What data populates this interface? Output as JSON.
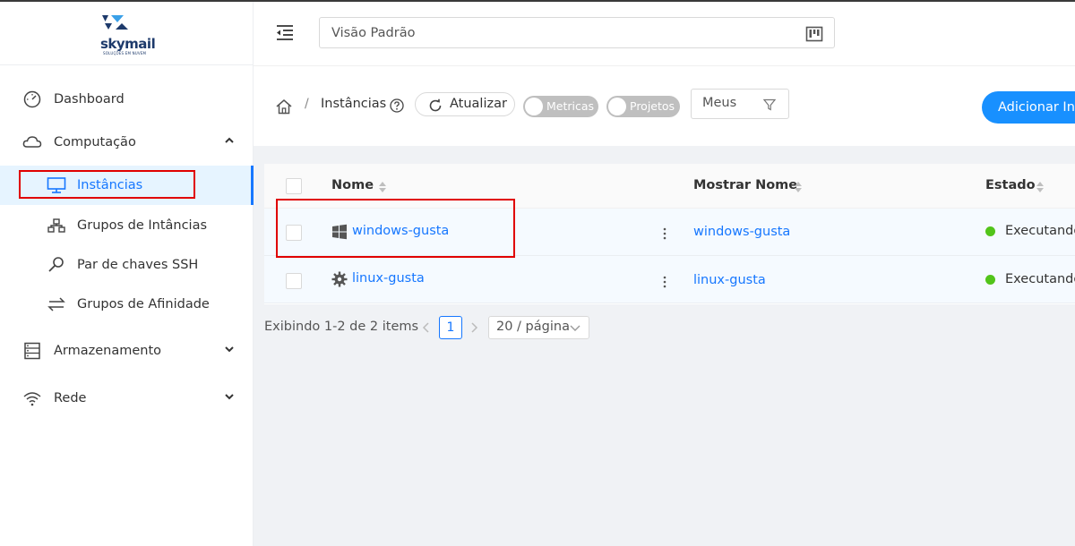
{
  "brand": {
    "name": "skymail",
    "tagline": "SOLUÇÕES EM NUVEM",
    "accent": "#1677ff",
    "primary_button": "#1890ff",
    "status_running": "#52c41a",
    "highlight_box": "#e00000"
  },
  "sidebar": {
    "items": [
      {
        "label": "Dashboard",
        "icon": "dashboard-icon"
      },
      {
        "label": "Computação",
        "icon": "cloud-icon",
        "expanded": true,
        "children": [
          {
            "label": "Instâncias",
            "icon": "monitor-icon",
            "active": true
          },
          {
            "label": "Grupos de Intâncias",
            "icon": "cluster-icon"
          },
          {
            "label": "Par de chaves SSH",
            "icon": "key-icon"
          },
          {
            "label": "Grupos de Afinidade",
            "icon": "swap-icon"
          }
        ]
      },
      {
        "label": "Armazenamento",
        "icon": "database-icon",
        "expanded": false
      },
      {
        "label": "Rede",
        "icon": "wifi-icon",
        "expanded": false
      }
    ]
  },
  "header": {
    "view_label": "Visão Padrão",
    "menu_icon": "menu-fold-icon",
    "view_icon": "project-board-icon"
  },
  "toolbar": {
    "breadcrumb_current": "Instâncias",
    "breadcrumb_separator": "/",
    "refresh_label": "Atualizar",
    "toggle_metrics": "Metricas",
    "toggle_projects": "Projetos",
    "filter_value": "Meus",
    "add_label": "Adicionar Instância"
  },
  "table": {
    "columns": [
      "Nome",
      "Mostrar Nome",
      "Estado"
    ],
    "rows": [
      {
        "name": "windows-gusta",
        "os_icon": "windows-icon",
        "display_name": "windows-gusta",
        "state": "Executando"
      },
      {
        "name": "linux-gusta",
        "os_icon": "gear-icon",
        "display_name": "linux-gusta",
        "state": "Executando"
      }
    ]
  },
  "pagination": {
    "summary": "Exibindo 1-2 de 2 items",
    "current_page": "1",
    "page_size": "20 / página"
  }
}
